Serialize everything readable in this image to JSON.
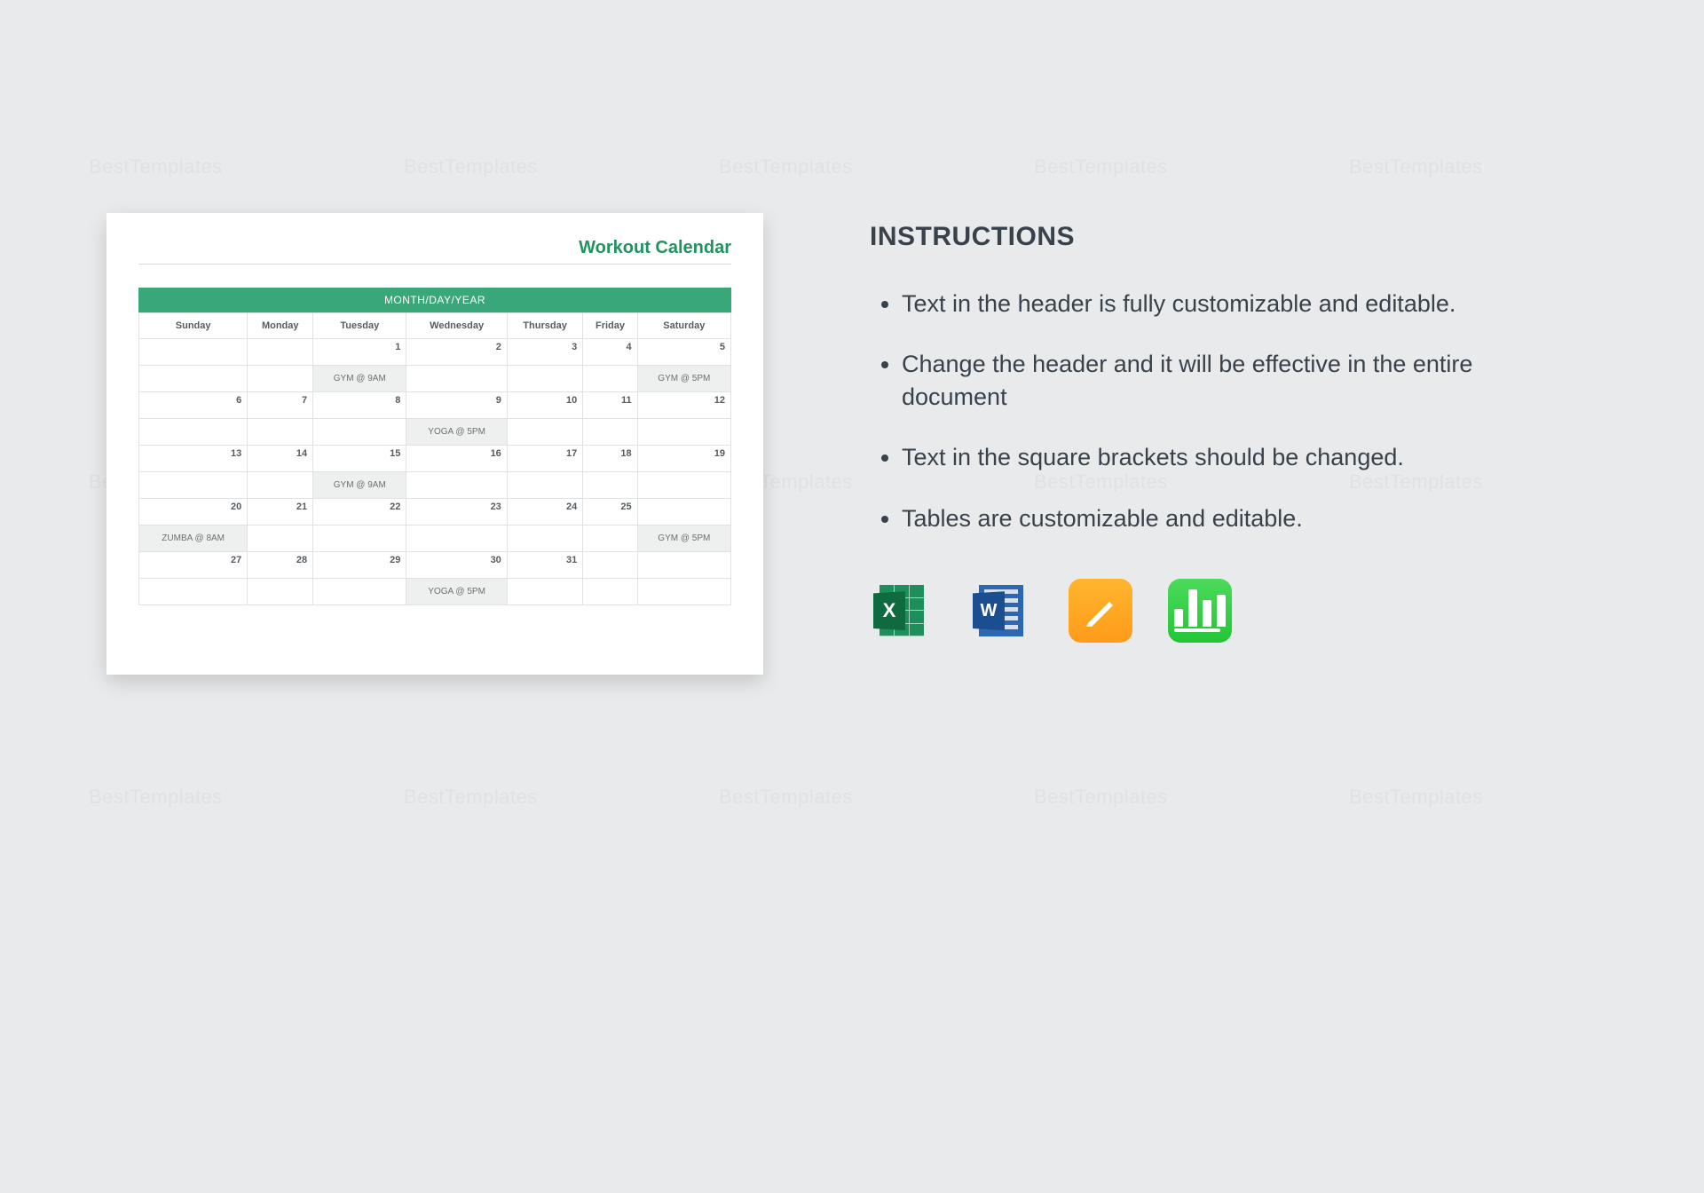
{
  "watermark_text": "BestTemplates",
  "preview": {
    "title": "Workout Calendar",
    "banner": "MONTH/DAY/YEAR",
    "days": [
      "Sunday",
      "Monday",
      "Tuesday",
      "Wednesday",
      "Thursday",
      "Friday",
      "Saturday"
    ],
    "rows": [
      {
        "nums": [
          "",
          "",
          "1",
          "2",
          "3",
          "4",
          "5"
        ],
        "events": [
          "",
          "",
          "GYM @ 9AM",
          "",
          "",
          "",
          "GYM @ 5PM"
        ]
      },
      {
        "nums": [
          "6",
          "7",
          "8",
          "9",
          "10",
          "11",
          "12"
        ],
        "events": [
          "",
          "",
          "",
          "YOGA @ 5PM",
          "",
          "",
          ""
        ]
      },
      {
        "nums": [
          "13",
          "14",
          "15",
          "16",
          "17",
          "18",
          "19"
        ],
        "events": [
          "",
          "",
          "GYM @ 9AM",
          "",
          "",
          "",
          ""
        ]
      },
      {
        "nums": [
          "20",
          "21",
          "22",
          "23",
          "24",
          "25",
          ""
        ],
        "events": [
          "ZUMBA @ 8AM",
          "",
          "",
          "",
          "",
          "",
          "GYM @ 5PM"
        ]
      },
      {
        "nums": [
          "27",
          "28",
          "29",
          "30",
          "31",
          "",
          ""
        ],
        "events": [
          "",
          "",
          "",
          "YOGA @ 5PM",
          "",
          "",
          ""
        ]
      }
    ]
  },
  "instructions": {
    "heading": "INSTRUCTIONS",
    "items": [
      "Text in the header is fully customizable and editable.",
      "Change the header and it will be effective in the entire document",
      "Text in the square brackets should be changed.",
      "Tables are customizable and editable."
    ]
  },
  "apps": {
    "excel": "X",
    "word": "W",
    "pages": "pages-icon",
    "numbers": "numbers-icon"
  }
}
